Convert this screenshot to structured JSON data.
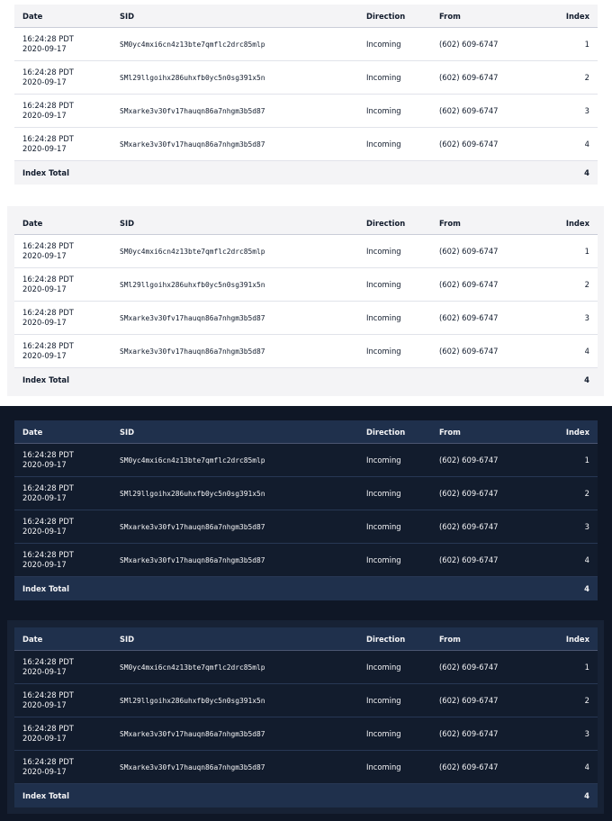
{
  "columns": {
    "date": "Date",
    "sid": "SID",
    "direction": "Direction",
    "from": "From",
    "index": "Index"
  },
  "rows": [
    {
      "time": "16:24:28 PDT",
      "date": "2020-09-17",
      "sid": "SM0yc4mxi6cn4z13bte7qmflc2drc85mlp",
      "direction": "Incoming",
      "from": "(602) 609-6747",
      "index": "1"
    },
    {
      "time": "16:24:28 PDT",
      "date": "2020-09-17",
      "sid": "SMl29llgoihx286uhxfb0yc5n0sg391x5n",
      "direction": "Incoming",
      "from": "(602) 609-6747",
      "index": "2"
    },
    {
      "time": "16:24:28 PDT",
      "date": "2020-09-17",
      "sid": "SMxarke3v30fv17hauqn86a7nhgm3b5d87",
      "direction": "Incoming",
      "from": "(602) 609-6747",
      "index": "3"
    },
    {
      "time": "16:24:28 PDT",
      "date": "2020-09-17",
      "sid": "SMxarke3v30fv17hauqn86a7nhgm3b5d87",
      "direction": "Incoming",
      "from": "(602) 609-6747",
      "index": "4"
    }
  ],
  "total": {
    "label": "Index Total",
    "value": "4"
  },
  "themes": {
    "light_bg": "#ffffff",
    "light_header_bg": "#f4f4f6",
    "light_text": "#121c2d",
    "dark_bg": "#0f1726",
    "dark_panel_bg": "#121c2d",
    "dark_header_bg": "#1f304c",
    "dark_text": "#f4f4f6"
  }
}
